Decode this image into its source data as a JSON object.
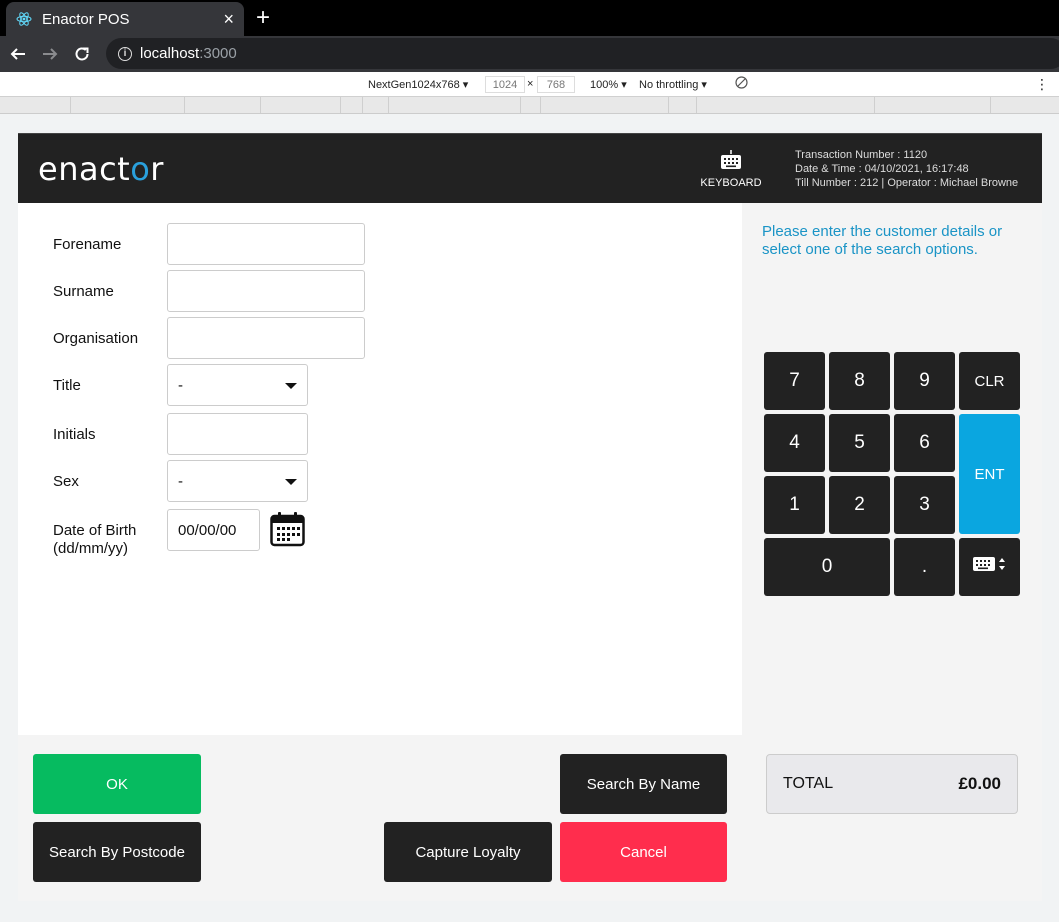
{
  "browser": {
    "tab_title": "Enactor POS",
    "close_glyph": "×",
    "newtab_glyph": "+",
    "url_host": "localhost",
    "url_port": ":3000",
    "devtools": {
      "device": "NextGen1024x768 ▾",
      "width": "1024",
      "times": "×",
      "height": "768",
      "zoom": "100% ▾",
      "throttle": "No throttling ▾"
    }
  },
  "header": {
    "logo_pre": "enact",
    "logo_o": "o",
    "logo_post": "r",
    "keyboard_label": "KEYBOARD",
    "transaction": "Transaction Number : 1120",
    "datetime": "Date & Time : 04/10/2021, 16:17:48",
    "till": "Till Number : 212  |  Operator : Michael Browne"
  },
  "form": {
    "forename_label": "Forename",
    "surname_label": "Surname",
    "organisation_label": "Organisation",
    "title_label": "Title",
    "title_value": "-",
    "initials_label": "Initials",
    "sex_label": "Sex",
    "sex_value": "-",
    "dob_label_1": "Date of Birth",
    "dob_label_2": "(dd/mm/yy)",
    "dob_value": "00/00/00"
  },
  "prompt": "Please enter the customer details or select one of the search options.",
  "keypad": {
    "k7": "7",
    "k8": "8",
    "k9": "9",
    "clr": "CLR",
    "k4": "4",
    "k5": "5",
    "k6": "6",
    "ent": "ENT",
    "k1": "1",
    "k2": "2",
    "k3": "3",
    "k0": "0",
    "dot": "."
  },
  "buttons": {
    "ok": "OK",
    "search_name": "Search By Name",
    "search_postcode": "Search By Postcode",
    "capture_loyalty": "Capture Loyalty",
    "cancel": "Cancel"
  },
  "total": {
    "label": "TOTAL",
    "value": "£0.00"
  },
  "colors": {
    "accent": "#0aa6e0",
    "ok": "#06bb60",
    "cancel": "#ff2d4d",
    "dark": "#222222"
  }
}
